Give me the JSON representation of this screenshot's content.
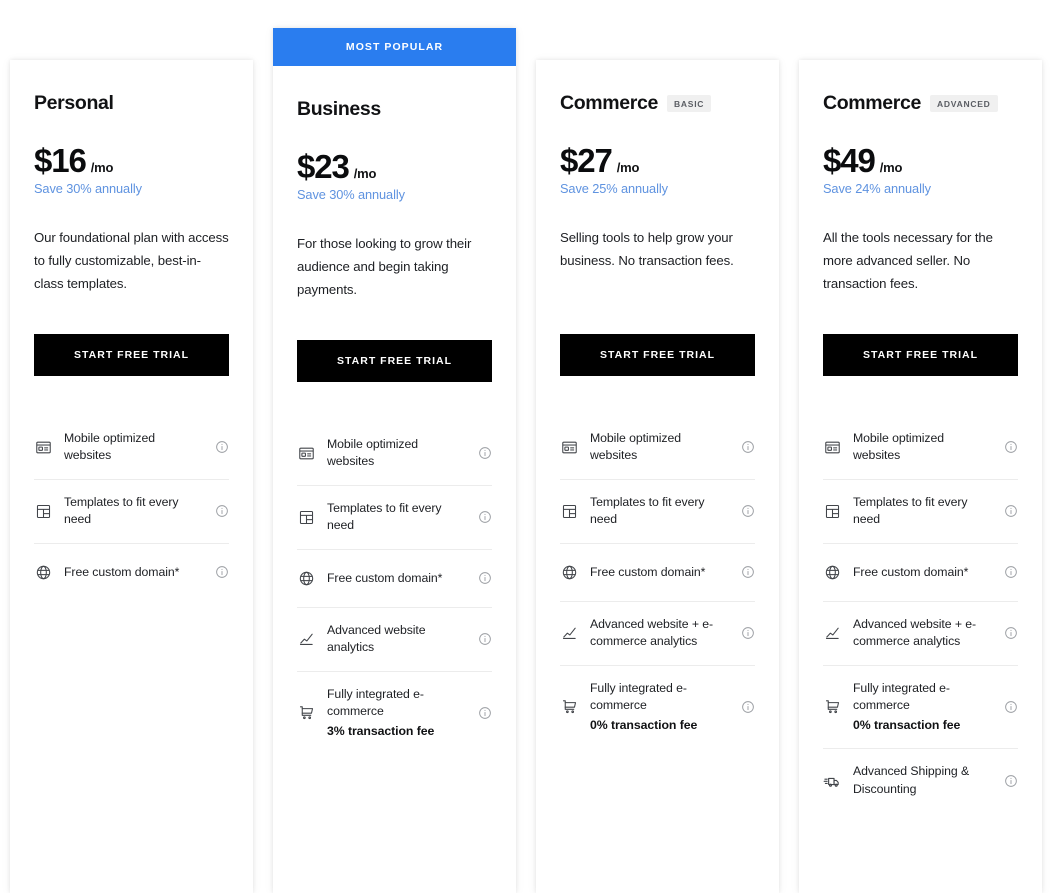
{
  "colors": {
    "accent_blue": "#2a7def",
    "save_text_blue": "#5f93e0",
    "cta_background": "#000000",
    "badge_background": "#f0f0f0",
    "page_background": "#ffffff"
  },
  "ribbon": {
    "label": "MOST POPULAR"
  },
  "plans": [
    {
      "name": "Personal",
      "badge": "",
      "featured": false,
      "price": "$16",
      "period": "/mo",
      "save": "Save 30% annually",
      "description": "Our foundational plan with access to fully customizable, best-in-class templates.",
      "cta": "START FREE TRIAL",
      "features": [
        {
          "icon": "mobile-window-icon",
          "text": "Mobile optimized websites",
          "sub": "",
          "info": "info-icon"
        },
        {
          "icon": "templates-layout-icon",
          "text": "Templates to fit every need",
          "sub": "",
          "info": "info-icon"
        },
        {
          "icon": "globe-icon",
          "text": "Free custom domain*",
          "sub": "",
          "info": "info-icon"
        }
      ]
    },
    {
      "name": "Business",
      "badge": "",
      "featured": true,
      "price": "$23",
      "period": "/mo",
      "save": "Save 30% annually",
      "description": "For those looking to grow their audience and begin taking payments.",
      "cta": "START FREE TRIAL",
      "features": [
        {
          "icon": "mobile-window-icon",
          "text": "Mobile optimized websites",
          "sub": "",
          "info": "info-icon"
        },
        {
          "icon": "templates-layout-icon",
          "text": "Templates to fit every need",
          "sub": "",
          "info": "info-icon"
        },
        {
          "icon": "globe-icon",
          "text": "Free custom domain*",
          "sub": "",
          "info": "info-icon"
        },
        {
          "icon": "analytics-chart-icon",
          "text": "Advanced website analytics",
          "sub": "",
          "info": "info-icon"
        },
        {
          "icon": "shopping-cart-icon",
          "text": "Fully integrated e-commerce",
          "sub": "3% transaction fee",
          "info": "info-icon"
        }
      ]
    },
    {
      "name": "Commerce",
      "badge": "BASIC",
      "featured": false,
      "price": "$27",
      "period": "/mo",
      "save": "Save 25% annually",
      "description": "Selling tools to help grow your business. No transaction fees.",
      "cta": "START FREE TRIAL",
      "features": [
        {
          "icon": "mobile-window-icon",
          "text": "Mobile optimized websites",
          "sub": "",
          "info": "info-icon"
        },
        {
          "icon": "templates-layout-icon",
          "text": "Templates to fit every need",
          "sub": "",
          "info": "info-icon"
        },
        {
          "icon": "globe-icon",
          "text": "Free custom domain*",
          "sub": "",
          "info": "info-icon"
        },
        {
          "icon": "analytics-chart-icon",
          "text": "Advanced website + e-commerce analytics",
          "sub": "",
          "info": "info-icon"
        },
        {
          "icon": "shopping-cart-icon",
          "text": "Fully integrated e-commerce",
          "sub": "0% transaction fee",
          "info": "info-icon"
        }
      ]
    },
    {
      "name": "Commerce",
      "badge": "ADVANCED",
      "featured": false,
      "price": "$49",
      "period": "/mo",
      "save": "Save 24% annually",
      "description": "All the tools necessary for the more advanced seller. No transaction fees.",
      "cta": "START FREE TRIAL",
      "features": [
        {
          "icon": "mobile-window-icon",
          "text": "Mobile optimized websites",
          "sub": "",
          "info": "info-icon"
        },
        {
          "icon": "templates-layout-icon",
          "text": "Templates to fit every need",
          "sub": "",
          "info": "info-icon"
        },
        {
          "icon": "globe-icon",
          "text": "Free custom domain*",
          "sub": "",
          "info": "info-icon"
        },
        {
          "icon": "analytics-chart-icon",
          "text": "Advanced website + e-commerce analytics",
          "sub": "",
          "info": "info-icon"
        },
        {
          "icon": "shopping-cart-icon",
          "text": "Fully integrated e-commerce",
          "sub": "0% transaction fee",
          "info": "info-icon"
        },
        {
          "icon": "delivery-truck-icon",
          "text": "Advanced Shipping & Discounting",
          "sub": "",
          "info": "info-icon"
        }
      ]
    }
  ]
}
